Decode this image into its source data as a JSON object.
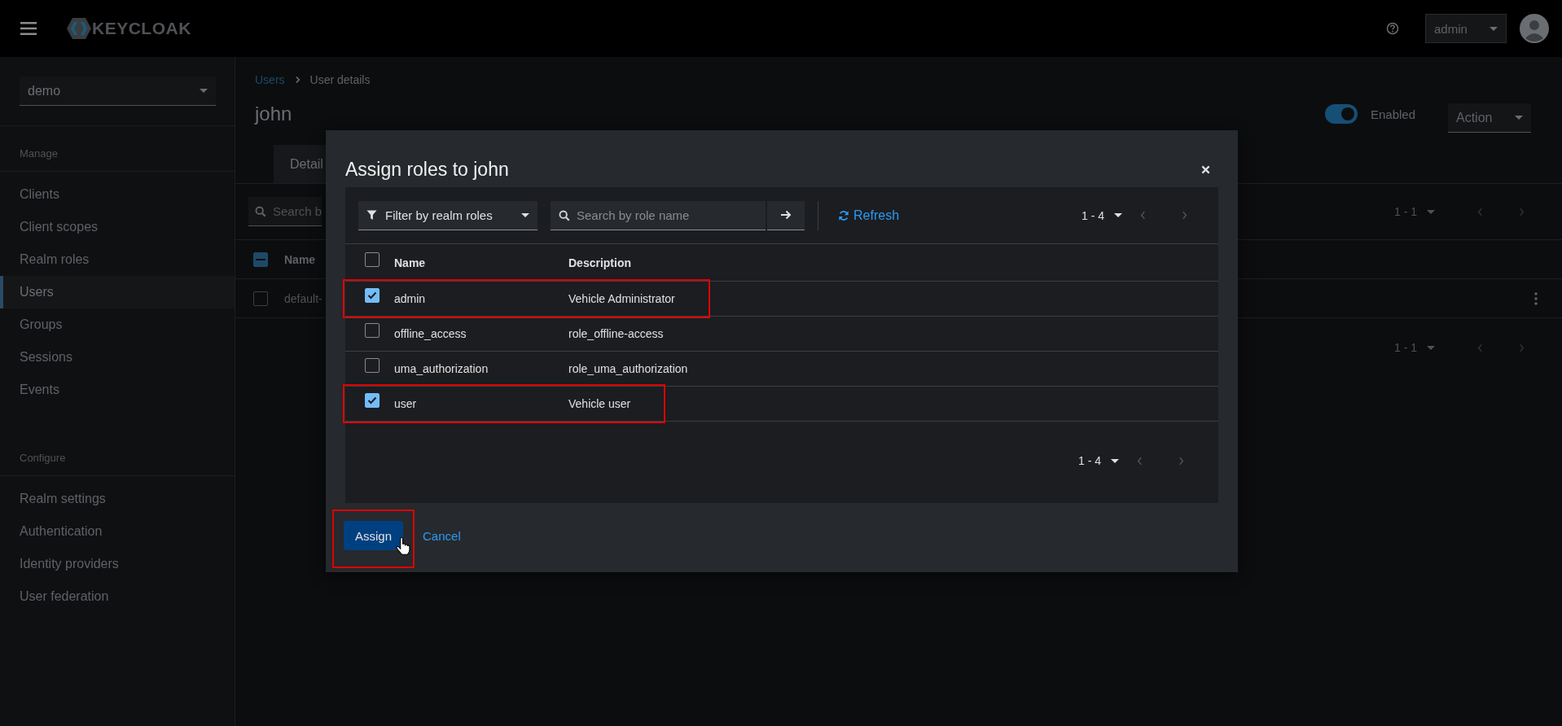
{
  "header": {
    "logo": "KEYCLOAK",
    "user_menu": "admin"
  },
  "sidebar": {
    "realm": "demo",
    "sections": [
      {
        "title": "Manage",
        "items": [
          {
            "label": "Clients",
            "selected": false
          },
          {
            "label": "Client scopes",
            "selected": false
          },
          {
            "label": "Realm roles",
            "selected": false
          },
          {
            "label": "Users",
            "selected": true
          },
          {
            "label": "Groups",
            "selected": false
          },
          {
            "label": "Sessions",
            "selected": false
          },
          {
            "label": "Events",
            "selected": false
          }
        ]
      },
      {
        "title": "Configure",
        "items": [
          {
            "label": "Realm settings",
            "selected": false
          },
          {
            "label": "Authentication",
            "selected": false
          },
          {
            "label": "Identity providers",
            "selected": false
          },
          {
            "label": "User federation",
            "selected": false
          }
        ]
      }
    ]
  },
  "main": {
    "breadcrumb": [
      "Users",
      "User details"
    ],
    "title": "john",
    "enabled": true,
    "enabled_label": "Enabled",
    "action": "Action",
    "tabs": [
      {
        "label": "Detail",
        "selected": true
      }
    ],
    "search": {
      "placeholder": "Search b"
    },
    "pagination": "1 - 1",
    "table": {
      "select_all_partial": true,
      "columns": [
        "Name"
      ],
      "rows": [
        {
          "name": "default-",
          "checked": false
        }
      ]
    },
    "bottom_pagination": "1 - 1"
  },
  "dialog": {
    "title": "Assign roles to john",
    "filter": "Filter by realm roles",
    "search": {
      "placeholder": "Search by role name"
    },
    "refresh": "Refresh",
    "pagination": "1 - 4",
    "select_all": false,
    "columns": [
      "Name",
      "Description"
    ],
    "rows": [
      {
        "name": "admin",
        "description": "Vehicle Administrator",
        "checked": true,
        "highlighted": true
      },
      {
        "name": "offline_access",
        "description": "role_offline-access",
        "checked": false,
        "highlighted": false
      },
      {
        "name": "uma_authorization",
        "description": "role_uma_authorization",
        "checked": false,
        "highlighted": false
      },
      {
        "name": "user",
        "description": "Vehicle user",
        "checked": true,
        "highlighted": true
      }
    ],
    "bottom_pagination": "1 - 4",
    "buttons": [
      {
        "label": "Assign",
        "kind": "primary",
        "highlighted": true
      },
      {
        "label": "Cancel",
        "kind": "link",
        "highlighted": false
      }
    ]
  }
}
